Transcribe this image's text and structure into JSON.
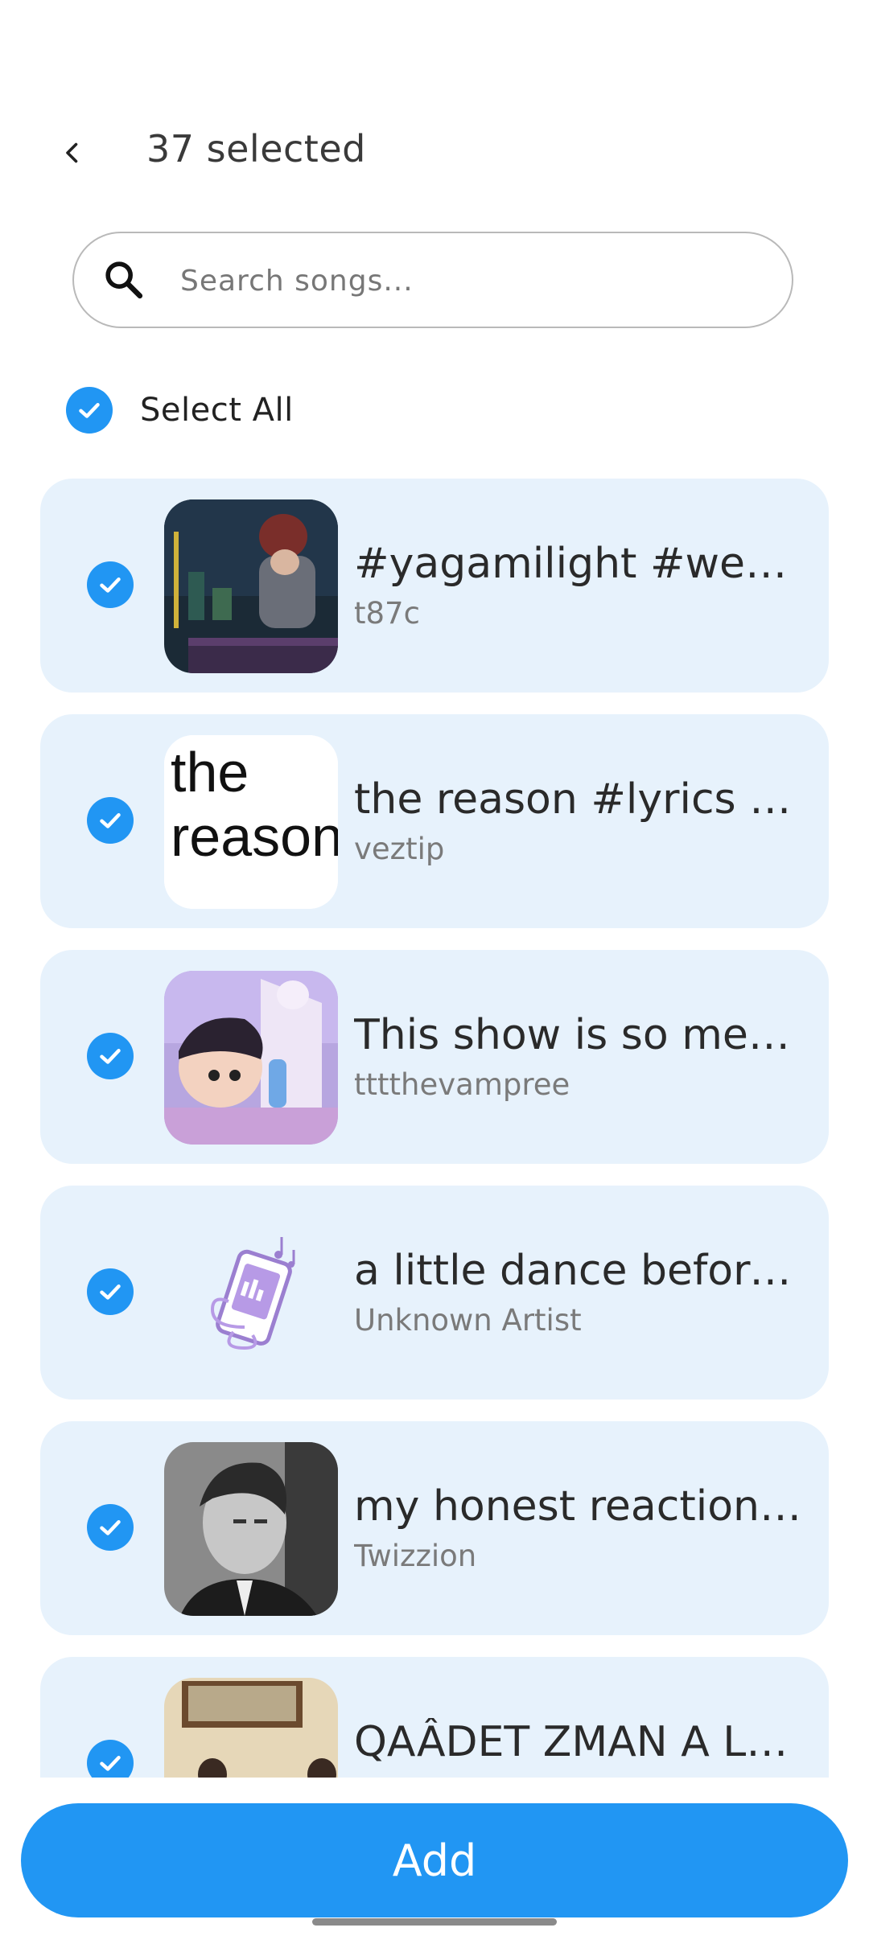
{
  "header": {
    "title": "37 selected",
    "back_icon": "chevron-left-icon"
  },
  "search": {
    "placeholder": "Search songs...",
    "value": "",
    "icon": "search-icon"
  },
  "select_all": {
    "label": "Select All",
    "checked": true
  },
  "songs": [
    {
      "title": "#yagamilight #wek...",
      "artist": "t87c",
      "checked": true
    },
    {
      "title": "the reason #lyrics #...",
      "artist": "veztip",
      "checked": true,
      "thumb_text_1": "the",
      "thumb_text_2": "reason"
    },
    {
      "title": "This show is so mes...",
      "artist": "tttthevampree",
      "checked": true
    },
    {
      "title": "a little dance before ...",
      "artist": "Unknown Artist",
      "checked": true
    },
    {
      "title": "my honest reaction (...",
      "artist": "Twizzion",
      "checked": true
    },
    {
      "title": "QAÂDET ZMAN A LE PL...",
      "artist": "",
      "checked": true
    }
  ],
  "footer": {
    "add_label": "Add"
  },
  "colors": {
    "accent": "#2196F3",
    "card_bg": "#E7F2FC"
  }
}
